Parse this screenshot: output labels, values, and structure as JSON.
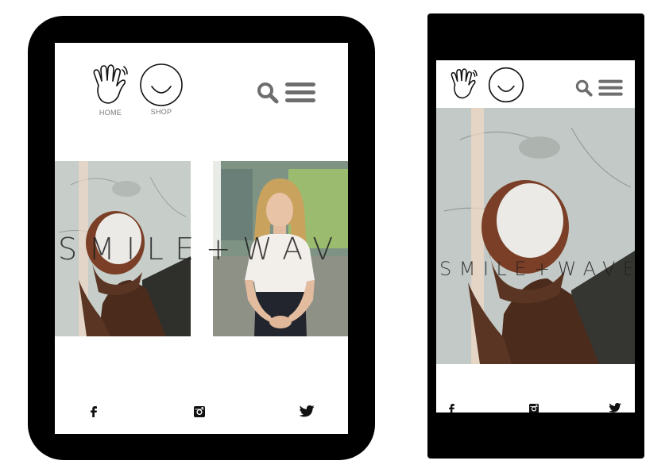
{
  "tablet": {
    "nav": {
      "home_label": "HOME",
      "shop_label": "SHOP"
    },
    "brand_text": "SMILE+WAVE",
    "social": [
      "facebook-icon",
      "instagram-icon",
      "twitter-icon"
    ]
  },
  "phone": {
    "brand_text": "SMILE+WAVE",
    "social": [
      "facebook-icon",
      "instagram-icon",
      "twitter-icon"
    ]
  },
  "colors": {
    "icon_gray": "#6d6d6d",
    "device": "#000000",
    "screen": "#ffffff"
  }
}
